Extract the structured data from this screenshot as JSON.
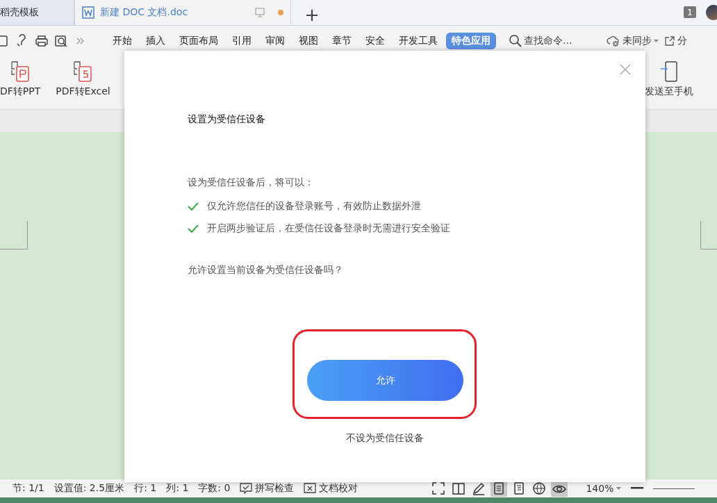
{
  "tabs": [
    {
      "label": "稻壳模板",
      "selected": false,
      "kind": "plain"
    },
    {
      "label": "新建 DOC 文档.doc",
      "selected": true,
      "kind": "doc"
    }
  ],
  "notification_count": "1",
  "menu": [
    {
      "label": "开始",
      "selected": false
    },
    {
      "label": "插入",
      "selected": false
    },
    {
      "label": "页面布局",
      "selected": false
    },
    {
      "label": "引用",
      "selected": false
    },
    {
      "label": "审阅",
      "selected": false
    },
    {
      "label": "视图",
      "selected": false
    },
    {
      "label": "章节",
      "selected": false
    },
    {
      "label": "安全",
      "selected": false
    },
    {
      "label": "开发工具",
      "selected": false
    },
    {
      "label": "特色应用",
      "selected": true
    }
  ],
  "search": {
    "placeholder": "查找命令..."
  },
  "sync": "未同步",
  "share": "分",
  "ribbon_left": [
    {
      "label": "DF转PPT",
      "kind": "ppt"
    },
    {
      "label": "PDF转Excel",
      "kind": "excel"
    }
  ],
  "ribbon_right": [
    {
      "label": "发送至手机",
      "kind": "phone"
    }
  ],
  "dialog": {
    "title": "设置为受信任设备",
    "intro": "设为受信任设备后，将可以：",
    "benefits": [
      "仅允许您信任的设备登录账号，有效防止数据外泄",
      "开启两步验证后，在受信任设备登录时无需进行安全验证"
    ],
    "question": "允许设置当前设备为受信任设备吗？",
    "allow_button": "允许",
    "decline_link": "不设为受信任设备"
  },
  "status_bar": {
    "items": [
      "节: 1/1",
      "设置值: 2.5厘米",
      "行: 1",
      "列: 1",
      "字数: 0"
    ],
    "spell_check": "拼写检查",
    "proofread": "文档校对",
    "zoom": "140%",
    "view_buttons": [
      {
        "kind": "fullscreen",
        "selected": false
      },
      {
        "kind": "book",
        "selected": false
      },
      {
        "kind": "pen",
        "selected": false
      },
      {
        "kind": "page",
        "selected": true
      },
      {
        "kind": "outline",
        "selected": false
      },
      {
        "kind": "web",
        "selected": false
      },
      {
        "kind": "eye",
        "selected": true
      }
    ]
  }
}
